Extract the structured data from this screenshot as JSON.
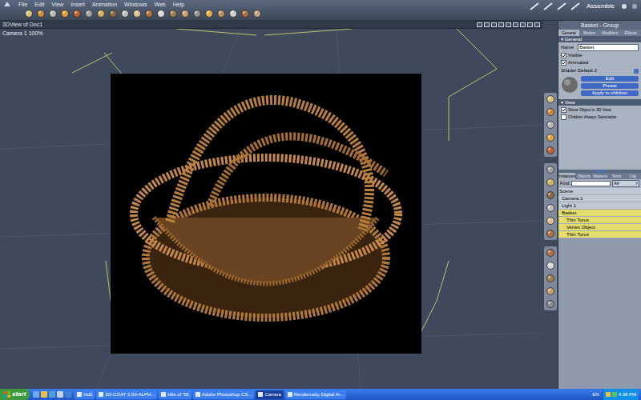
{
  "menu": [
    "File",
    "Edit",
    "View",
    "Insert",
    "Animation",
    "Windows",
    "Web",
    "Help"
  ],
  "room": "Assemble",
  "view": {
    "title": "3DView of Doc1",
    "camera": "Camera 1 100%"
  },
  "properties": {
    "title": "Basket - Group",
    "tabs": [
      {
        "label": "General",
        "selected": true
      },
      {
        "label": "Motion",
        "selected": false
      },
      {
        "label": "Modifiers",
        "selected": false
      },
      {
        "label": "Effects",
        "selected": false
      }
    ],
    "section": "General",
    "name_label": "Name",
    "name": "Basket",
    "checks": [
      {
        "label": "Visible",
        "checked": true
      },
      {
        "label": "Animated",
        "checked": true
      }
    ],
    "shader_label": "Shader",
    "shader": "Default 2",
    "buttons": [
      "Edit",
      "Preset",
      "Apply to children"
    ],
    "view_section": "View",
    "view_checks": [
      {
        "label": "Show Object in 3D View",
        "checked": true
      },
      {
        "label": "Children Always Selectable",
        "checked": false
      }
    ]
  },
  "browser": {
    "tabs": [
      {
        "label": "Instances",
        "selected": true
      },
      {
        "label": "Objects",
        "selected": false
      },
      {
        "label": "Masters",
        "selected": false
      },
      {
        "label": "Texts",
        "selected": false
      },
      {
        "label": "Clip",
        "selected": false
      }
    ],
    "find_label": "Find",
    "filter": "All",
    "tree": [
      {
        "label": "Scene",
        "depth": 0,
        "selected": false
      },
      {
        "label": "Camera 1",
        "depth": 1,
        "selected": false
      },
      {
        "label": "Light 1",
        "depth": 1,
        "selected": false
      },
      {
        "label": "Basket",
        "depth": 1,
        "selected": true
      },
      {
        "label": "Thin Torus",
        "depth": 2,
        "selected": true
      },
      {
        "label": "Vertex Object",
        "depth": 2,
        "selected": true
      },
      {
        "label": "Thin Torus",
        "depth": 2,
        "selected": true
      }
    ]
  },
  "taskbar": {
    "start": "start",
    "tasks": [
      {
        "label": "Hd2",
        "selected": false
      },
      {
        "label": "3D-COAT 2.00-ALPH...",
        "selected": false
      },
      {
        "label": "Hits of '56",
        "selected": false
      },
      {
        "label": "Adobe Photoshop CS...",
        "selected": false
      },
      {
        "label": "Carrara",
        "selected": true
      },
      {
        "label": "Renderosity Digital Ar...",
        "selected": false
      }
    ],
    "lang": "EN",
    "time": "4:38 PM"
  }
}
